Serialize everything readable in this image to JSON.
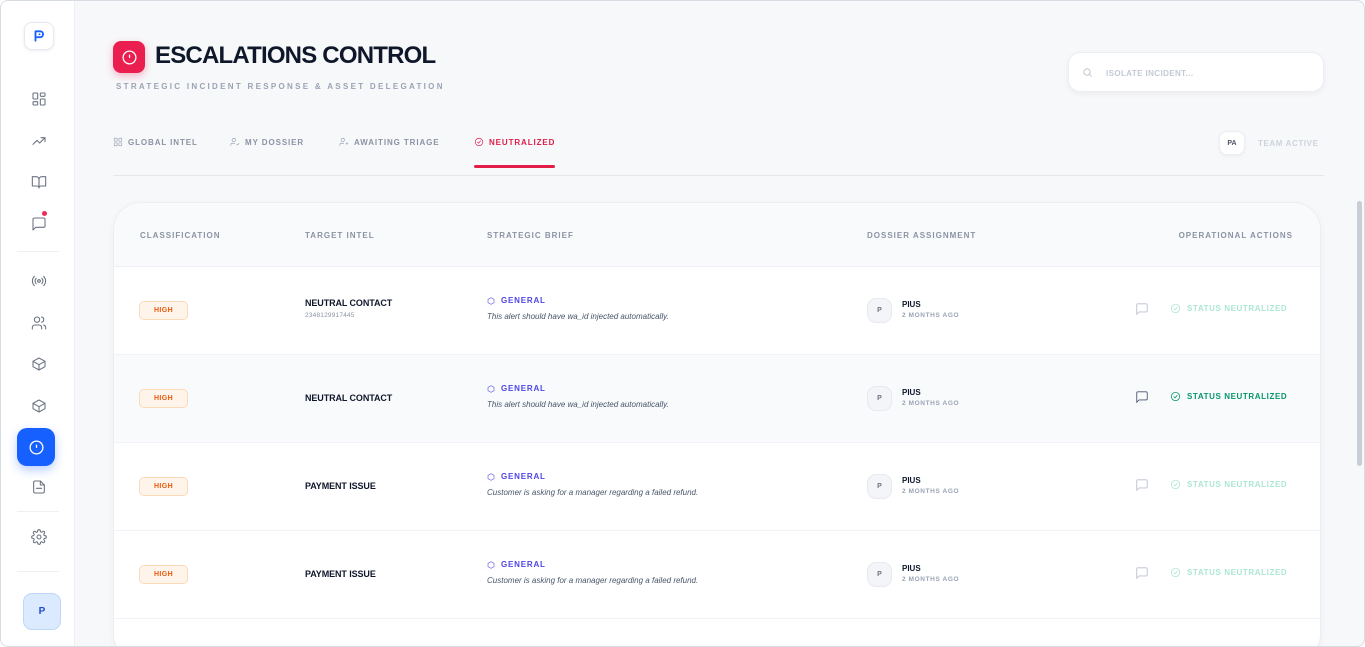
{
  "sidebar": {
    "logo_letter": "P",
    "nav": [
      {
        "name": "dashboard",
        "icon": "grid-icon"
      },
      {
        "name": "analytics",
        "icon": "trending-up-icon"
      },
      {
        "name": "knowledge",
        "icon": "book-icon"
      },
      {
        "name": "messages",
        "icon": "chat-icon",
        "has_notification": true
      },
      {
        "name": "broadcast",
        "icon": "radio-icon"
      },
      {
        "name": "contacts",
        "icon": "users-icon"
      },
      {
        "name": "products",
        "icon": "box-icon"
      },
      {
        "name": "inventory",
        "icon": "box-icon"
      },
      {
        "name": "escalations",
        "icon": "alert-circle-icon",
        "active": true
      },
      {
        "name": "reports",
        "icon": "file-icon"
      },
      {
        "name": "settings",
        "icon": "gear-icon"
      }
    ],
    "user_initial": "P",
    "active_color": "#1660ff"
  },
  "header": {
    "title": "ESCALATIONS CONTROL",
    "subtitle": "STRATEGIC INCIDENT RESPONSE & ASSET DELEGATION",
    "badge_color": "#ea1f4f"
  },
  "search": {
    "placeholder": "ISOLATE INCIDENT...",
    "value": ""
  },
  "tabs": [
    {
      "label": "GLOBAL INTEL",
      "icon": "grid-icon",
      "active": false
    },
    {
      "label": "MY DOSSIER",
      "icon": "user-check-icon",
      "active": false
    },
    {
      "label": "AWAITING TRIAGE",
      "icon": "user-plus-icon",
      "active": false
    },
    {
      "label": "NEUTRALIZED",
      "icon": "check-circle-icon",
      "active": true
    }
  ],
  "team": {
    "initials": "PA",
    "label": "TEAM ACTIVE"
  },
  "table": {
    "columns": {
      "classification": "CLASSIFICATION",
      "target": "TARGET INTEL",
      "brief": "STRATEGIC BRIEF",
      "assignment": "DOSSIER ASSIGNMENT",
      "actions": "OPERATIONAL ACTIONS"
    },
    "rows": [
      {
        "priority": "HIGH",
        "target_name": "NEUTRAL CONTACT",
        "target_phone": "2348129917445",
        "brief_tag": "GENERAL",
        "brief_text": "This alert should have wa_id injected automatically.",
        "assignee_initial": "P",
        "assignee_name": "PIUS",
        "assigned_time": "2 MONTHS AGO",
        "status": "STATUS NEUTRALIZED"
      },
      {
        "priority": "HIGH",
        "target_name": "NEUTRAL CONTACT",
        "target_phone": "",
        "brief_tag": "GENERAL",
        "brief_text": "This alert should have wa_id injected automatically.",
        "assignee_initial": "P",
        "assignee_name": "PIUS",
        "assigned_time": "2 MONTHS AGO",
        "status": "STATUS NEUTRALIZED",
        "hovered": true
      },
      {
        "priority": "HIGH",
        "target_name": "PAYMENT ISSUE",
        "target_phone": "",
        "brief_tag": "GENERAL",
        "brief_text": "Customer is asking for a manager regarding a failed refund.",
        "assignee_initial": "P",
        "assignee_name": "PIUS",
        "assigned_time": "2 MONTHS AGO",
        "status": "STATUS NEUTRALIZED"
      },
      {
        "priority": "HIGH",
        "target_name": "PAYMENT ISSUE",
        "target_phone": "",
        "brief_tag": "GENERAL",
        "brief_text": "Customer is asking for a manager regarding a failed refund.",
        "assignee_initial": "P",
        "assignee_name": "PIUS",
        "assigned_time": "2 MONTHS AGO",
        "status": "STATUS NEUTRALIZED"
      }
    ]
  },
  "colors": {
    "accent_red": "#e11d48",
    "priority_orange": "#ea580c",
    "tag_indigo": "#4f46e5",
    "status_green": "#059669"
  }
}
